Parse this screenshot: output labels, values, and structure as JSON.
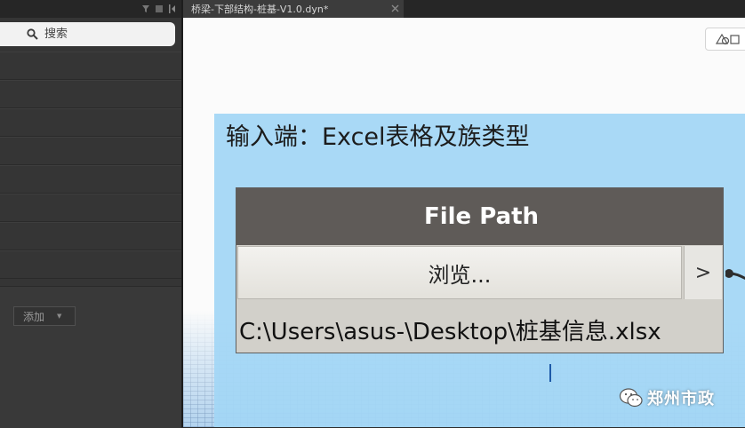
{
  "tab": {
    "title": "桥梁-下部结构-桩基-V1.0.dyn*"
  },
  "library": {
    "search": {
      "placeholder": "搜索",
      "value": ""
    },
    "add_button": {
      "label": "添加"
    }
  },
  "workspace": {
    "group": {
      "title": "输入端：Excel表格及族类型"
    },
    "node": {
      "title": "File Path",
      "browse_label": "浏览...",
      "output_port_label": ">",
      "file_path": "C:\\Users\\asus-\\Desktop\\桩基信息.xlsx"
    }
  },
  "watermark": {
    "text": "郑州市政"
  }
}
